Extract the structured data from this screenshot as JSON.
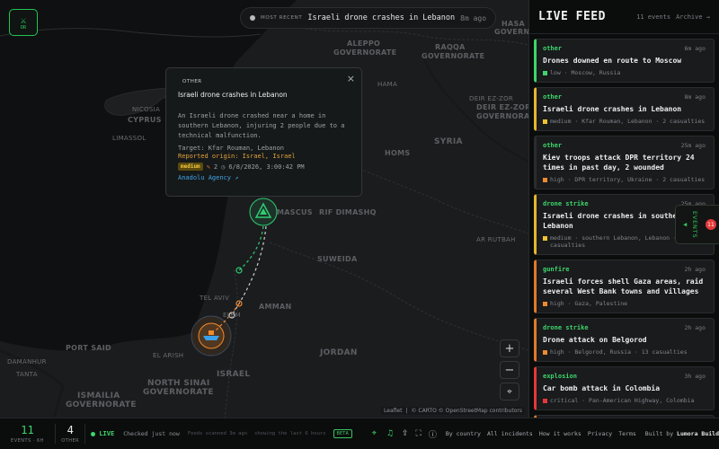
{
  "app": {
    "logo_icon": "crossed-swords-icon",
    "logo_sub": "DR"
  },
  "recent": {
    "label": "MOST RECENT",
    "title": "Israeli drone crashes in Lebanon",
    "ago": "8m ago"
  },
  "popup": {
    "category": "OTHER",
    "title": "Israeli drone crashes in Lebanon",
    "description": "An Israeli drone crashed near a home in southern Lebanon, injuring 2 people due to a technical malfunction.",
    "target": "Target: Kfar Rouman, Lebanon",
    "origin": "Reported origin: Israel, Israel",
    "severity": "medium",
    "casualties": "2",
    "datetime": "6/8/2026, 3:00:42 PM",
    "source": "Anadolu Agency ↗",
    "close": "×"
  },
  "map": {
    "labels": {
      "hasa": "HASA",
      "governorate_tr": "GOVERN",
      "aleppo": "ALEPPO",
      "aleppo_gov": "GOVERNORATE",
      "raqqa": "RAQQA",
      "raqqa_gov": "GOVERNORATE",
      "nicosia": "NICOSIA",
      "cyprus": "CYPRUS",
      "limassol": "Limassol",
      "hama": "HAMA",
      "deir": "Deir ez-Zor",
      "deir_gov1": "DEIR EZ-ZOR",
      "deir_gov2": "GOVERNORATE",
      "syria": "SYRIA",
      "homs": "HOMS",
      "damascus": "MASCUS",
      "rif": "RIF DIMASHQ",
      "suweida": "SUWEIDA",
      "tel_aviv": "TEL AVIV",
      "amman": "AMMAN",
      "jordan": "JORDAN",
      "israel": "ISRAEL",
      "north_sinai1": "NORTH SINAI",
      "north_sinai2": "GOVERNORATE",
      "ismailia1": "ISMAILIA",
      "ismailia2": "GOVERNORATE",
      "port_said": "PORT SAID",
      "al_rutbah": "Ar Rutbah",
      "el_arish": "El Arish",
      "tanta": "Tanta",
      "damanhur": "Damanhur",
      "el_jem": "ELEM"
    },
    "zoom_in": "+",
    "zoom_out": "−",
    "locate_icon": "crosshair-icon",
    "attribution": {
      "leaflet": "Leaflet",
      "carto": "© CARTO",
      "osm": "© OpenStreetMap contributors"
    }
  },
  "sidebar": {
    "title": "LIVE FEED",
    "count": "11 events",
    "archive": "Archive →",
    "cards": [
      {
        "category": "other",
        "ago": "6m ago",
        "title": "Drones downed en route to Moscow",
        "meta": "low · Moscow, Russia",
        "color": "#3ed66a",
        "border": "#3ed66a"
      },
      {
        "category": "other",
        "ago": "8m ago",
        "title": "Israeli drone crashes in Lebanon",
        "meta": "medium · Kfar Rouman, Lebanon · 2 casualties",
        "color": "#f0c232",
        "border": "#e6b52e"
      },
      {
        "category": "other",
        "ago": "25m ago",
        "title": "Kiev troops attack DPR territory 24 times in past day, 2 wounded",
        "meta": "high · DPR territory, Ukraine · 2 casualties",
        "color": "#f08a2e",
        "border": "#2a2d30"
      },
      {
        "category": "drone strike",
        "ago": "25m ago",
        "title": "Israeli drone crashes in southern Lebanon",
        "meta": "medium · southern Lebanon, Lebanon · 2 casualties",
        "color": "#f0c232",
        "border": "#e6b52e"
      },
      {
        "category": "gunfire",
        "ago": "2h ago",
        "title": "Israeli forces shell Gaza areas, raid several West Bank towns and villages",
        "meta": "high · Gaza, Palestine",
        "color": "#f08a2e",
        "border": "#e07a2a"
      },
      {
        "category": "drone strike",
        "ago": "2h ago",
        "title": "Drone attack on Belgorod",
        "meta": "high · Belgorod, Russia · 13 casualties",
        "color": "#f08a2e",
        "border": "#e07a2a"
      },
      {
        "category": "explosion",
        "ago": "3h ago",
        "title": "Car bomb attack in Colombia",
        "meta": "critical · Pan-American Highway, Colombia",
        "color": "#e43838",
        "border": "#e43838"
      },
      {
        "category": "naval",
        "ago": "3h ago",
        "title": "",
        "meta": "",
        "color": "#f08a2e",
        "border": "#e07a2a"
      }
    ],
    "events_tab": {
      "label": "EVENTS",
      "badge": "11"
    }
  },
  "footer": {
    "events_count": "11",
    "events_label": "EVENTS · 6H",
    "other_count": "4",
    "other_label": "OTHER",
    "live": "LIVE",
    "checked": "Checked just now",
    "feeds": "Feeds scanned 3m ago",
    "showing": "showing the last 6 hours",
    "beta": "BETA",
    "links": [
      "By country",
      "All incidents",
      "How it works",
      "Privacy",
      "Terms"
    ],
    "built_prefix": "Built by",
    "built_name": "Lumora Build"
  }
}
